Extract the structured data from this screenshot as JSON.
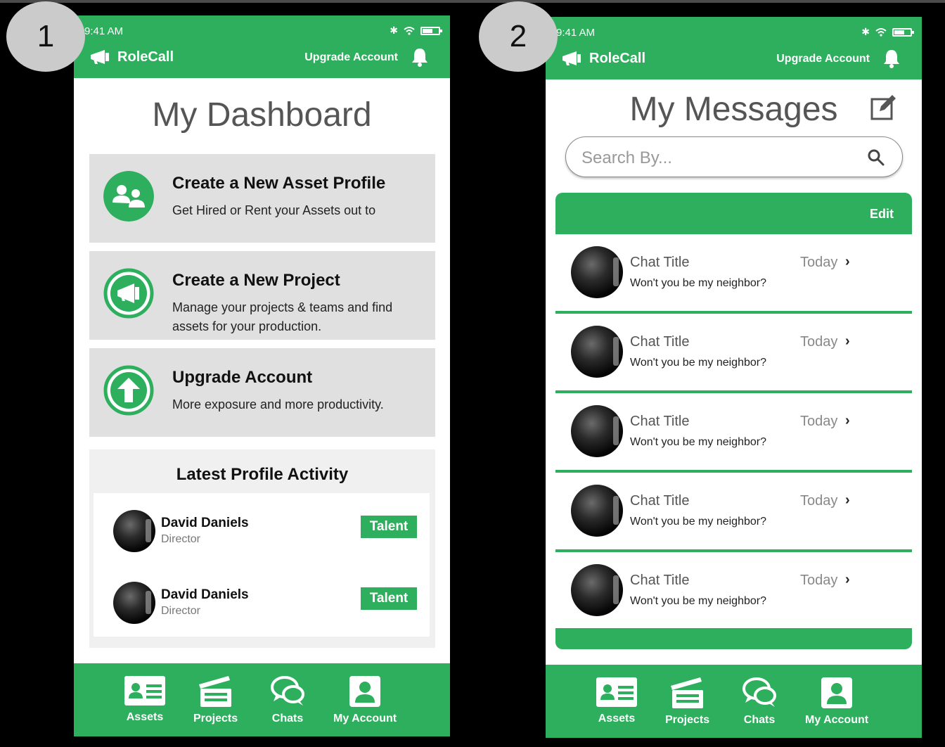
{
  "badges": [
    "1",
    "2"
  ],
  "status": {
    "time": "9:41 AM"
  },
  "header": {
    "brand": "RoleCall",
    "upgrade_label": "Upgrade Account"
  },
  "brand_color": "#2daf5e",
  "dashboard": {
    "title": "My Dashboard",
    "cards": [
      {
        "title": "Create a New Asset Profile",
        "desc": "Get Hired or Rent your Assets out to",
        "icon": "people-icon"
      },
      {
        "title": "Create a New Project",
        "desc": "Manage your projects & teams and find assets for your production.",
        "icon": "megaphone-icon"
      },
      {
        "title": "Upgrade Account",
        "desc": "More exposure and more productivity.",
        "icon": "arrow-up-icon"
      }
    ],
    "activity": {
      "title": "Latest Profile Activity",
      "rows": [
        {
          "name": "David Daniels",
          "role": "Director",
          "tag": "Talent"
        },
        {
          "name": "David Daniels",
          "role": "Director",
          "tag": "Talent"
        }
      ]
    }
  },
  "messages": {
    "title": "My Messages",
    "search_placeholder": "Search By...",
    "edit_label": "Edit",
    "items": [
      {
        "title": "Chat Title",
        "time": "Today",
        "preview": "Won't you be my neighbor?"
      },
      {
        "title": "Chat Title",
        "time": "Today",
        "preview": "Won't you be my neighbor?"
      },
      {
        "title": "Chat Title",
        "time": "Today",
        "preview": "Won't you be my neighbor?"
      },
      {
        "title": "Chat Title",
        "time": "Today",
        "preview": "Won't you be my neighbor?"
      },
      {
        "title": "Chat Title",
        "time": "Today",
        "preview": "Won't you be my neighbor?"
      }
    ]
  },
  "nav": [
    "Assets",
    "Projects",
    "Chats",
    "My Account"
  ]
}
